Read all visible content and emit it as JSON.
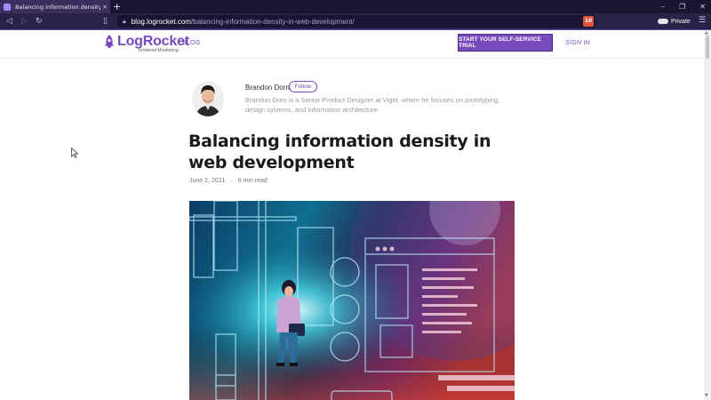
{
  "browser": {
    "tab_title": "Balancing information density in w...",
    "tab_close": "×",
    "new_tab": "+",
    "url_host": "blog.logrocket.com",
    "url_path": "/balancing-information-density-in-web-development/",
    "private_label": "Private",
    "shield_count": "10"
  },
  "header": {
    "logo_name": "LogRocket",
    "logo_tagline": "Frontend Monitoring",
    "nav_blog": "BLOG",
    "trial_button": "START YOUR SELF-SERVICE TRIAL",
    "sign_in": "SIGN IN"
  },
  "author": {
    "name": "Brandon Dorn",
    "follow_label": "Follow",
    "bio": "Brandon Dorn is a Senior Product Designer at Viget, where he focuses on prototyping, design systems, and information architecture."
  },
  "article": {
    "title": "Balancing information density in web development",
    "date": "June 2, 2021",
    "separator": "·",
    "read_time": "6 min read"
  },
  "colors": {
    "brand": "#764abc",
    "chrome_dark": "#1a1430",
    "chrome_toolbar": "#2a2148"
  },
  "icons": {
    "back": "back-arrow-icon",
    "forward": "forward-arrow-icon",
    "reload": "reload-icon",
    "bookmark": "bookmark-icon",
    "lock": "lock-icon",
    "shield": "brave-shield-icon",
    "private": "private-mask-icon",
    "menu": "hamburger-menu-icon"
  }
}
